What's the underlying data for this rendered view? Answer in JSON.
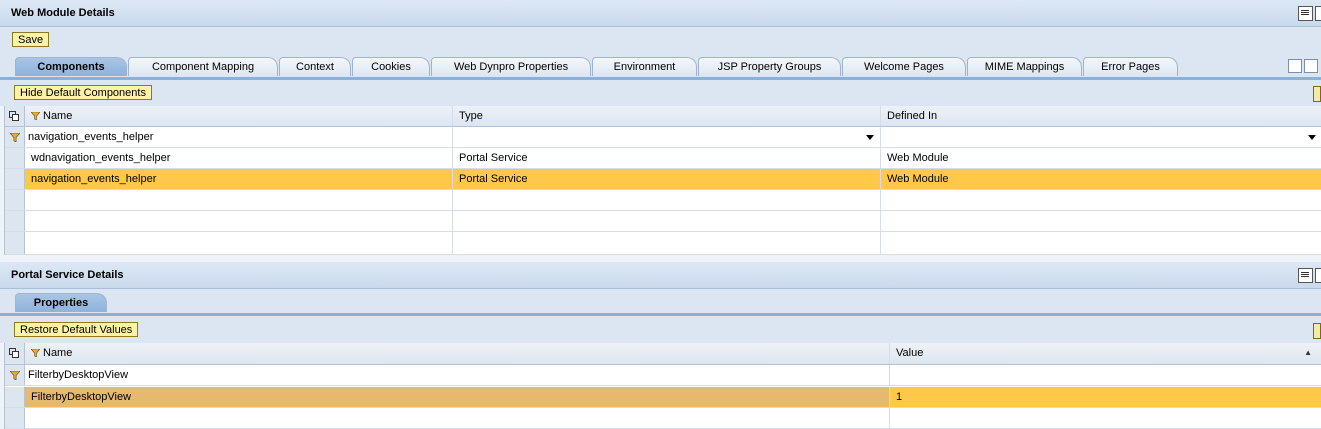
{
  "web_module": {
    "title": "Web Module Details",
    "save_label": "Save",
    "tabs": [
      {
        "label": "Components",
        "active": true
      },
      {
        "label": "Component Mapping"
      },
      {
        "label": "Context"
      },
      {
        "label": "Cookies"
      },
      {
        "label": "Web Dynpro Properties"
      },
      {
        "label": "Environment"
      },
      {
        "label": "JSP Property Groups"
      },
      {
        "label": "Welcome Pages"
      },
      {
        "label": "MIME Mappings"
      },
      {
        "label": "Error Pages"
      }
    ],
    "hide_default_label": "Hide Default Components",
    "columns": {
      "name": "Name",
      "type": "Type",
      "defined_in": "Defined In"
    },
    "filter": {
      "name": "navigation_events_helper",
      "type": "",
      "defined_in": ""
    },
    "rows": [
      {
        "name": "wdnavigation_events_helper",
        "type": "Portal Service",
        "defined_in": "Web Module",
        "selected": false
      },
      {
        "name": "navigation_events_helper",
        "type": "Portal Service",
        "defined_in": "Web Module",
        "selected": true
      }
    ]
  },
  "portal_service": {
    "title": "Portal Service Details",
    "tabs": [
      {
        "label": "Properties",
        "active": true
      }
    ],
    "restore_label": "Restore Default Values",
    "columns": {
      "name": "Name",
      "value": "Value"
    },
    "filter": {
      "name": "FilterbyDesktopView",
      "value": ""
    },
    "rows": [
      {
        "name": "FilterbyDesktopView",
        "value": "1",
        "selected": true
      }
    ]
  },
  "colors": {
    "selected_row": "#ffc849",
    "header_bg": "#c9d9ec",
    "button_bg": "#fdf2a5"
  }
}
